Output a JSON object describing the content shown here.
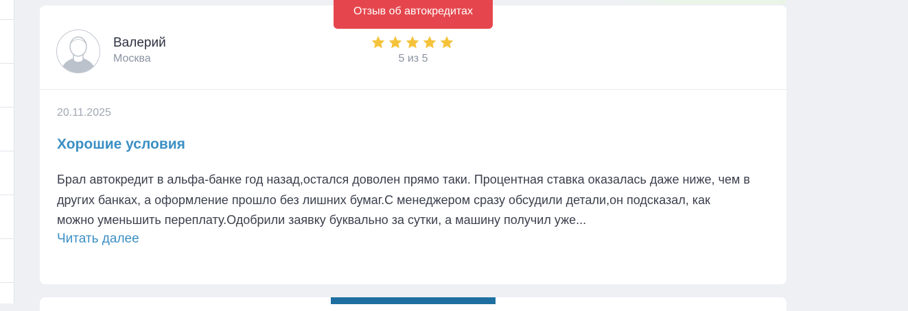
{
  "review": {
    "category_badge": "Отзыв об автокредитах",
    "author": {
      "name": "Валерий",
      "city": "Москва"
    },
    "rating": {
      "value": 5,
      "max": 5,
      "text": "5 из 5"
    },
    "date": "20.11.2025",
    "title": "Хорошие условия",
    "body": "Брал автокредит в альфа-банке год назад,остался доволен прямо таки. Процентная ставка оказалась даже ниже, чем в других банках, а оформление прошло без лишних бумаг.С менеджером сразу обсудили детали,он подсказал, как можно уменьшить переплату.Одобрили заявку буквально за сутки, а машину получил уже...",
    "read_more": "Читать далее"
  },
  "colors": {
    "badge": "#e5464d",
    "star": "#f5c33b",
    "link": "#3b8fc4",
    "next_badge": "#1e6fa0"
  },
  "icons": {
    "avatar": "user-silhouette-icon",
    "star": "star-icon"
  }
}
